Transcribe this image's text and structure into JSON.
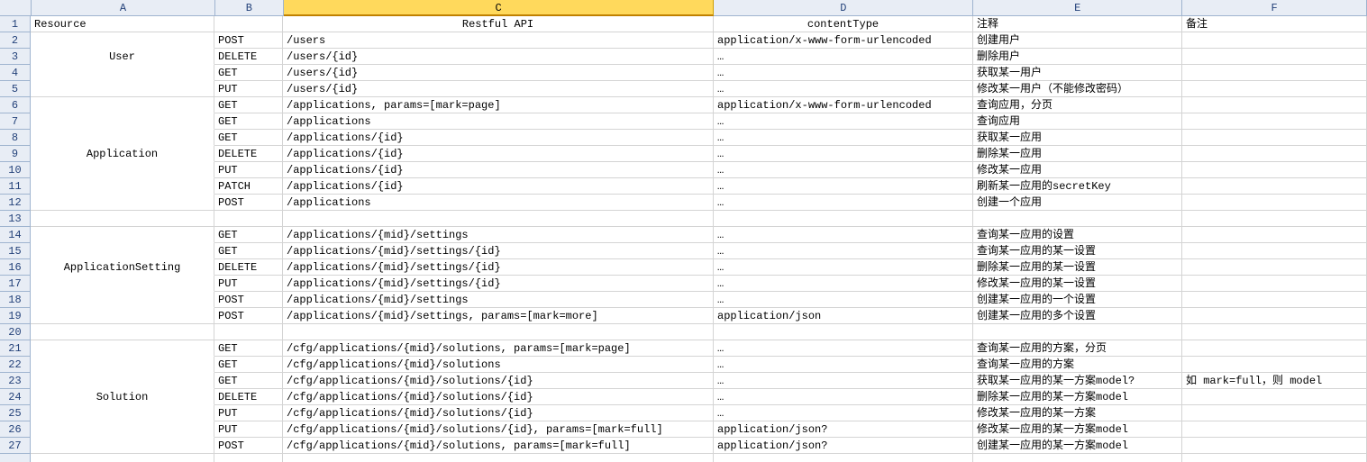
{
  "spreadsheet": {
    "columns": [
      "A",
      "B",
      "C",
      "D",
      "E",
      "F"
    ],
    "selectedColumn": "C",
    "row1": {
      "A": "Resource",
      "C": "Restful API",
      "D": "contentType",
      "E": "注释",
      "F": "备注"
    },
    "rows": [
      {
        "n": 2,
        "A": "",
        "B": "POST",
        "C": "/users",
        "D": "application/x-www-form-urlencoded",
        "E": "创建用户",
        "F": ""
      },
      {
        "n": 3,
        "A": "User",
        "B": "DELETE",
        "C": "/users/{id}",
        "D": "…",
        "E": "删除用户",
        "F": ""
      },
      {
        "n": 4,
        "A": "",
        "B": "GET",
        "C": "/users/{id}",
        "D": "…",
        "E": "获取某一用户",
        "F": ""
      },
      {
        "n": 5,
        "A": "",
        "B": "PUT",
        "C": "/users/{id}",
        "D": "…",
        "E": "修改某一用户（不能修改密码）",
        "F": ""
      },
      {
        "n": 6,
        "A": "",
        "B": "GET",
        "C": "/applications, params=[mark=page]",
        "D": "application/x-www-form-urlencoded",
        "E": "查询应用，分页",
        "F": ""
      },
      {
        "n": 7,
        "A": "",
        "B": "GET",
        "C": "/applications",
        "D": "…",
        "E": "查询应用",
        "F": ""
      },
      {
        "n": 8,
        "A": "",
        "B": "GET",
        "C": "/applications/{id}",
        "D": "…",
        "E": "获取某一应用",
        "F": ""
      },
      {
        "n": 9,
        "A": "Application",
        "B": "DELETE",
        "C": "/applications/{id}",
        "D": "…",
        "E": "删除某一应用",
        "F": ""
      },
      {
        "n": 10,
        "A": "",
        "B": "PUT",
        "C": "/applications/{id}",
        "D": "…",
        "E": "修改某一应用",
        "F": ""
      },
      {
        "n": 11,
        "A": "",
        "B": "PATCH",
        "C": "/applications/{id}",
        "D": "…",
        "E": "刷新某一应用的secretKey",
        "F": ""
      },
      {
        "n": 12,
        "A": "",
        "B": "POST",
        "C": "/applications",
        "D": "…",
        "E": "创建一个应用",
        "F": ""
      },
      {
        "n": 13,
        "A": "",
        "B": "",
        "C": "",
        "D": "",
        "E": "",
        "F": ""
      },
      {
        "n": 14,
        "A": "",
        "B": "GET",
        "C": "/applications/{mid}/settings",
        "D": "…",
        "E": "查询某一应用的设置",
        "F": ""
      },
      {
        "n": 15,
        "A": "",
        "B": "GET",
        "C": "/applications/{mid}/settings/{id}",
        "D": "…",
        "E": "查询某一应用的某一设置",
        "F": ""
      },
      {
        "n": 16,
        "A": "",
        "B": "DELETE",
        "C": "/applications/{mid}/settings/{id}",
        "D": "…",
        "E": "删除某一应用的某一设置",
        "F": ""
      },
      {
        "n": 17,
        "A": "ApplicationSetting",
        "B": "PUT",
        "C": "/applications/{mid}/settings/{id}",
        "D": "…",
        "E": "修改某一应用的某一设置",
        "F": ""
      },
      {
        "n": 18,
        "A": "",
        "B": "POST",
        "C": "/applications/{mid}/settings",
        "D": "…",
        "E": "创建某一应用的一个设置",
        "F": ""
      },
      {
        "n": 19,
        "A": "",
        "B": "POST",
        "C": "/applications/{mid}/settings, params=[mark=more]",
        "D": "application/json",
        "E": "创建某一应用的多个设置",
        "F": ""
      },
      {
        "n": 20,
        "A": "",
        "B": "",
        "C": "",
        "D": "",
        "E": "",
        "F": ""
      },
      {
        "n": 21,
        "A": "",
        "B": "GET",
        "C": "/cfg/applications/{mid}/solutions, params=[mark=page]",
        "D": "…",
        "E": "查询某一应用的方案，分页",
        "F": ""
      },
      {
        "n": 22,
        "A": "",
        "B": "GET",
        "C": "/cfg/applications/{mid}/solutions",
        "D": "…",
        "E": "查询某一应用的方案",
        "F": ""
      },
      {
        "n": 23,
        "A": "",
        "B": "GET",
        "C": "/cfg/applications/{mid}/solutions/{id}",
        "D": "…",
        "E": "获取某一应用的某一方案model?",
        "F": "如 mark=full，则 model"
      },
      {
        "n": 24,
        "A": "Solution",
        "B": "DELETE",
        "C": "/cfg/applications/{mid}/solutions/{id}",
        "D": "…",
        "E": "删除某一应用的某一方案model",
        "F": ""
      },
      {
        "n": 25,
        "A": "",
        "B": "PUT",
        "C": "/cfg/applications/{mid}/solutions/{id}",
        "D": "…",
        "E": "修改某一应用的某一方案",
        "F": ""
      },
      {
        "n": 26,
        "A": "",
        "B": "PUT",
        "C": "/cfg/applications/{mid}/solutions/{id}, params=[mark=full]",
        "D": "application/json?",
        "E": "修改某一应用的某一方案model",
        "F": ""
      },
      {
        "n": 27,
        "A": "",
        "B": "POST",
        "C": "/cfg/applications/{mid}/solutions, params=[mark=full]",
        "D": "application/json?",
        "E": "创建某一应用的某一方案model",
        "F": ""
      }
    ],
    "mergesA": {
      "2": {
        "rows": [
          2,
          3,
          4,
          5
        ],
        "label": "User"
      },
      "6": {
        "rows": [
          6,
          7,
          8,
          9,
          10,
          11,
          12
        ],
        "label": "Application"
      },
      "14": {
        "rows": [
          14,
          15,
          16,
          17,
          18,
          19
        ],
        "label": "ApplicationSetting"
      },
      "21": {
        "rows": [
          21,
          22,
          23,
          24,
          25,
          26,
          27
        ],
        "label": "Solution"
      }
    }
  }
}
